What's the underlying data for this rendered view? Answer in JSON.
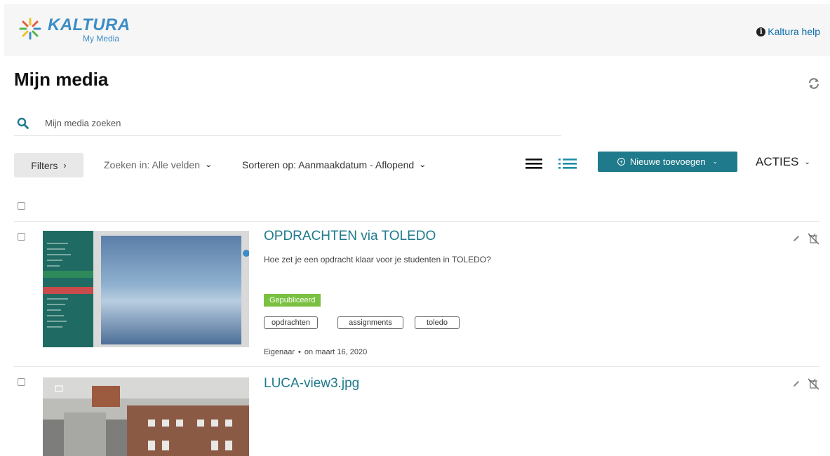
{
  "header": {
    "brand": "KALTURA",
    "subtitle": "My Media",
    "help_label": "Kaltura help"
  },
  "page": {
    "title": "Mijn media"
  },
  "search": {
    "placeholder": "Mijn media zoeken"
  },
  "toolbar": {
    "filters_label": "Filters",
    "search_in_label": "Zoeken in: Alle velden",
    "sort_label": "Sorteren op: Aanmaakdatum - Aflopend",
    "add_label": "Nieuwe toevoegen",
    "actions_label": "ACTIES"
  },
  "entries": [
    {
      "title": "OPDRACHTEN via TOLEDO",
      "description": "Hoe zet je een opdracht klaar voor je studenten in TOLEDO?",
      "status": "Gepubliceerd",
      "tags": [
        "opdrachten",
        "assignments",
        "toledo"
      ],
      "owner": "Eigenaar",
      "date": "on maart 16, 2020"
    },
    {
      "title": "LUCA-view3.jpg"
    }
  ],
  "colors": {
    "accent": "#1f7a8c",
    "published": "#7ac142",
    "link": "#0a6aa8"
  },
  "icons": {
    "logo": "kaltura-logo",
    "help": "info-icon",
    "refresh": "refresh-icon",
    "search": "search-icon",
    "list_view": "list-view-icon",
    "detail_view": "detailed-view-icon",
    "edit": "pencil-icon",
    "delete": "delete-icon"
  }
}
